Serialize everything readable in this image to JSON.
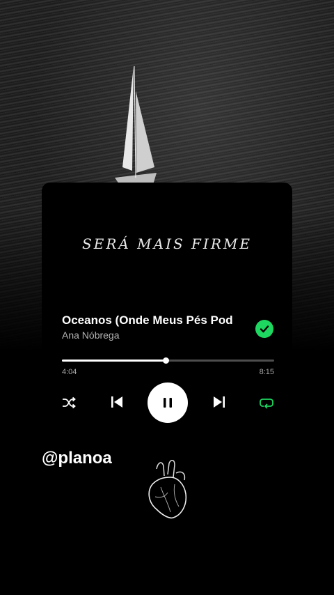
{
  "lyric": "SERÁ MAIS FIRME",
  "track": {
    "title": "Oceanos (Onde Meus Pés Pod",
    "artist": "Ana Nóbrega",
    "liked": true,
    "progress_fraction": 0.49
  },
  "times": {
    "elapsed": "4:04",
    "total": "8:15"
  },
  "controls": {
    "shuffle_icon": "shuffle-icon",
    "previous_icon": "skip-previous-icon",
    "play_icon": "pause-icon",
    "next_icon": "skip-next-icon",
    "repeat_icon": "repeat-icon",
    "repeat_color": "#1ed760"
  },
  "handle": "@planoa",
  "colors": {
    "accent": "#1ed760",
    "background": "#000000",
    "secondary_text": "#b3b3b3"
  }
}
